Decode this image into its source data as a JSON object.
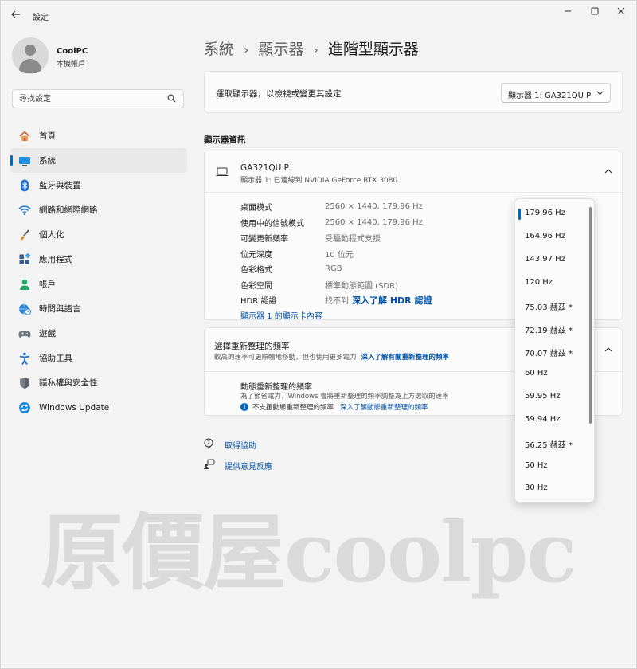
{
  "window": {
    "title": "設定"
  },
  "profile": {
    "name": "CoolPC",
    "subtitle": "本機帳戶"
  },
  "search": {
    "placeholder": "尋找設定"
  },
  "sidebar": {
    "items": [
      {
        "label": "首頁",
        "icon": "home-icon",
        "active": false
      },
      {
        "label": "系統",
        "icon": "system-icon",
        "active": true
      },
      {
        "label": "藍牙與裝置",
        "icon": "bluetooth-icon",
        "active": false
      },
      {
        "label": "網路和網際網路",
        "icon": "wifi-icon",
        "active": false
      },
      {
        "label": "個人化",
        "icon": "brush-icon",
        "active": false
      },
      {
        "label": "應用程式",
        "icon": "apps-icon",
        "active": false
      },
      {
        "label": "帳戶",
        "icon": "account-icon",
        "active": false
      },
      {
        "label": "時間與語言",
        "icon": "globe-clock-icon",
        "active": false
      },
      {
        "label": "遊戲",
        "icon": "gamepad-icon",
        "active": false
      },
      {
        "label": "協助工具",
        "icon": "accessibility-icon",
        "active": false
      },
      {
        "label": "隱私權與安全性",
        "icon": "shield-icon",
        "active": false
      },
      {
        "label": "Windows Update",
        "icon": "update-icon",
        "active": false
      }
    ]
  },
  "breadcrumb": {
    "items": [
      "系統",
      "顯示器",
      "進階型顯示器"
    ],
    "separator": "›"
  },
  "display_select": {
    "label": "選取顯示器，以檢視或變更其設定",
    "value": "顯示器 1: GA321QU P"
  },
  "display_info": {
    "section_title": "顯示器資訊",
    "monitor_name": "GA321QU P",
    "monitor_sub": "顯示器 1: 已連線到 NVIDIA GeForce RTX 3080",
    "rows": [
      {
        "key": "桌面模式",
        "value": "2560 × 1440, 179.96 Hz"
      },
      {
        "key": "使用中的信號模式",
        "value": "2560 × 1440, 179.96 Hz"
      },
      {
        "key": "可變更新頻率",
        "value": "受驅動程式支援"
      },
      {
        "key": "位元深度",
        "value": "10 位元"
      },
      {
        "key": "色彩格式",
        "value": "RGB"
      },
      {
        "key": "色彩空間",
        "value": "標準動態範圍 (SDR)"
      },
      {
        "key": "HDR 認證",
        "value": "找不到",
        "link": "深入了解 HDR 認證"
      }
    ],
    "adapter_link": "顯示器 1 的顯示卡內容"
  },
  "refresh": {
    "title": "選擇重新整理的頻率",
    "subtitle": "較高的速率可更順暢地移動，但也使用更多電力",
    "subtitle_link": "深入了解有關重新整理的頻率",
    "dynamic_title": "動態重新整理的頻率",
    "dynamic_sub": "為了節省電力，Windows 會將重新整理的頻率調整為上方選取的速率",
    "dynamic_note": "不支援動態重新整理的頻率",
    "dynamic_link": "深入了解動態重新整理的頻率"
  },
  "help": {
    "get_help": "取得協助",
    "feedback": "提供意見反應"
  },
  "refresh_options": {
    "selected": "179.96 Hz",
    "items": [
      "179.96 Hz",
      "164.96 Hz",
      "143.97 Hz",
      "120 Hz",
      "75.03 赫茲 *",
      "72.19 赫茲 *",
      "70.07 赫茲 *",
      "60 Hz",
      "59.95 Hz",
      "59.94 Hz",
      "56.25 赫茲 *",
      "50 Hz",
      "30 Hz"
    ]
  },
  "watermark": {
    "text": "原價屋coolpc"
  },
  "colors": {
    "accent": "#0067c0",
    "link": "#0050a6",
    "background": "#f3f3f3",
    "card": "#fbfbfb"
  }
}
